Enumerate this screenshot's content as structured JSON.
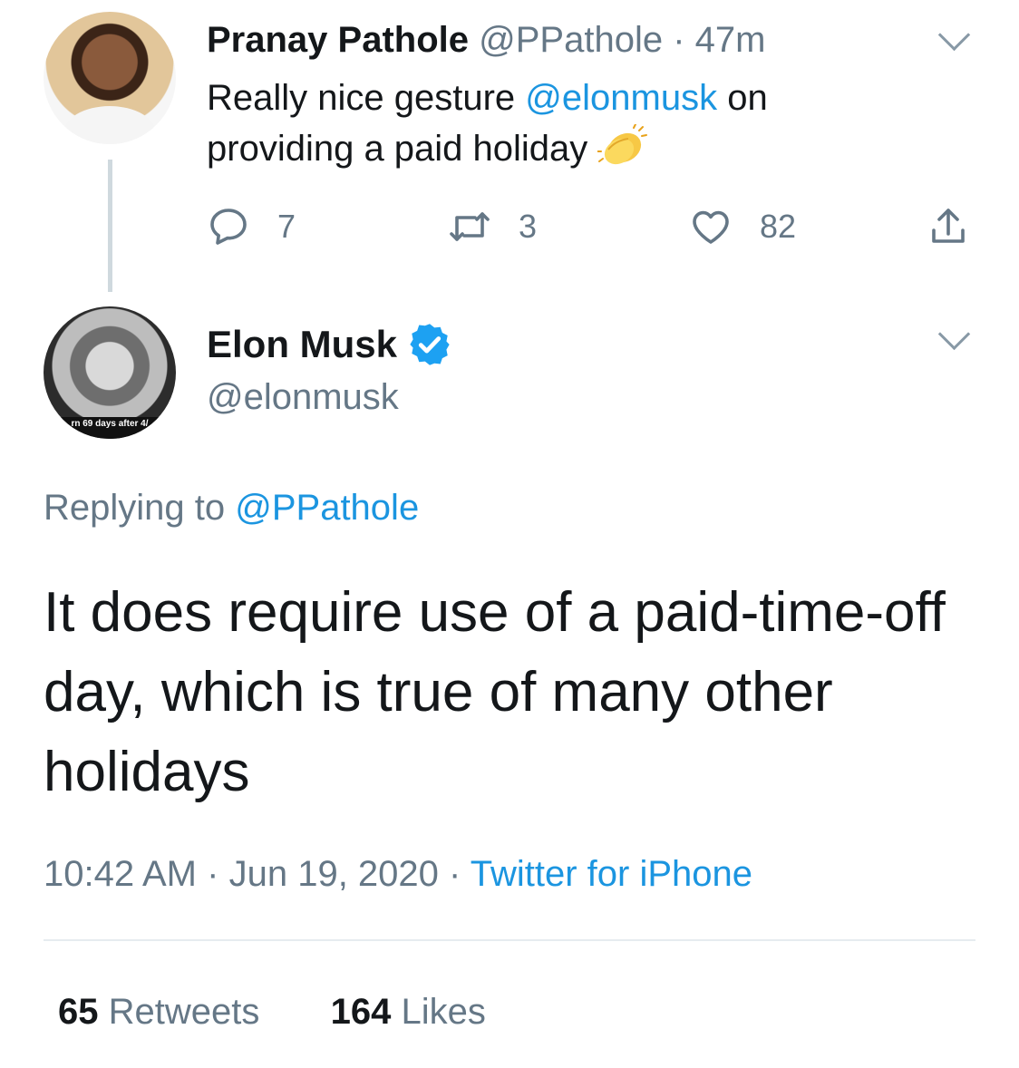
{
  "parent_tweet": {
    "author_name": "Pranay Pathole",
    "author_handle": "@PPathole",
    "separator": "·",
    "time_ago": "47m",
    "text_before": "Really nice gesture ",
    "mention": "@elonmusk",
    "text_after": " on providing a paid holiday",
    "emoji": "clapping-hands",
    "replies": "7",
    "retweets": "3",
    "likes": "82"
  },
  "main_tweet": {
    "author_name": "Elon Musk",
    "author_handle": "@elonmusk",
    "avatar_banner_text": "rn 69 days after 4/",
    "verified": true,
    "replying_prefix": "Replying to ",
    "replying_to": "@PPathole",
    "text": "It does require use of a paid-time-off day, which is true of many other holidays",
    "time": "10:42 AM",
    "date": "Jun 19, 2020",
    "source": "Twitter for iPhone",
    "meta_sep": "·",
    "retweet_count": "65",
    "retweet_label": "Retweets",
    "like_count": "164",
    "like_label": "Likes"
  },
  "colors": {
    "link": "#1b95e0",
    "muted": "#657786",
    "text": "#14171a",
    "verified": "#1da1f2"
  }
}
